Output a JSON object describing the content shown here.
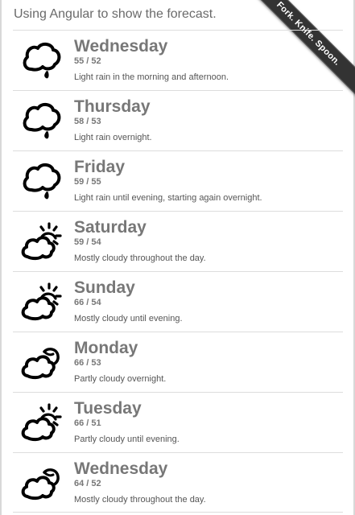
{
  "header": {
    "title": "Using Angular to show the forecast.",
    "ribbon_label": "Fork. Knife. Spoon."
  },
  "forecast": [
    {
      "day": "Wednesday",
      "temps": "55 / 52",
      "summary": "Light rain in the morning and afternoon.",
      "icon": "rain-icon"
    },
    {
      "day": "Thursday",
      "temps": "58 / 53",
      "summary": "Light rain overnight.",
      "icon": "rain-icon"
    },
    {
      "day": "Friday",
      "temps": "59 / 55",
      "summary": "Light rain until evening, starting again overnight.",
      "icon": "rain-icon"
    },
    {
      "day": "Saturday",
      "temps": "59 / 54",
      "summary": "Mostly cloudy throughout the day.",
      "icon": "partly-cloudy-day-icon"
    },
    {
      "day": "Sunday",
      "temps": "66 / 54",
      "summary": "Mostly cloudy until evening.",
      "icon": "partly-cloudy-day-icon"
    },
    {
      "day": "Monday",
      "temps": "66 / 53",
      "summary": "Partly cloudy overnight.",
      "icon": "partly-cloudy-night-icon"
    },
    {
      "day": "Tuesday",
      "temps": "66 / 51",
      "summary": "Partly cloudy until evening.",
      "icon": "partly-cloudy-day-icon"
    },
    {
      "day": "Wednesday",
      "temps": "64 / 52",
      "summary": "Mostly cloudy throughout the day.",
      "icon": "partly-cloudy-night-icon"
    }
  ],
  "colors": {
    "ribbon_bg": "#333333",
    "day_text": "#777777",
    "divider": "#dddddd"
  }
}
